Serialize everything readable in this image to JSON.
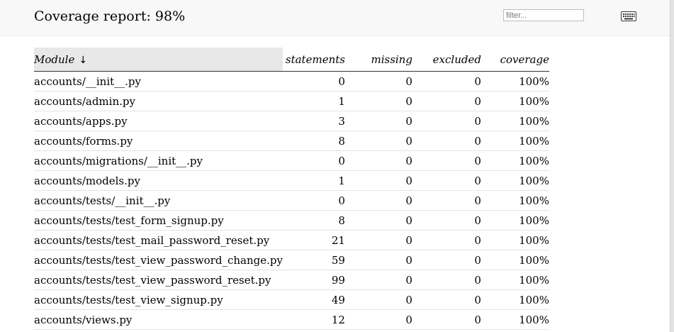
{
  "header": {
    "title": "Coverage report: 98%",
    "filter_placeholder": "filter...",
    "keyboard_icon": "keyboard-icon"
  },
  "table": {
    "columns": {
      "module": "Module",
      "sort_indicator": "↓",
      "statements": "statements",
      "missing": "missing",
      "excluded": "excluded",
      "coverage": "coverage"
    },
    "rows": [
      {
        "module": "accounts/__init__.py",
        "statements": "0",
        "missing": "0",
        "excluded": "0",
        "coverage": "100%"
      },
      {
        "module": "accounts/admin.py",
        "statements": "1",
        "missing": "0",
        "excluded": "0",
        "coverage": "100%"
      },
      {
        "module": "accounts/apps.py",
        "statements": "3",
        "missing": "0",
        "excluded": "0",
        "coverage": "100%"
      },
      {
        "module": "accounts/forms.py",
        "statements": "8",
        "missing": "0",
        "excluded": "0",
        "coverage": "100%"
      },
      {
        "module": "accounts/migrations/__init__.py",
        "statements": "0",
        "missing": "0",
        "excluded": "0",
        "coverage": "100%"
      },
      {
        "module": "accounts/models.py",
        "statements": "1",
        "missing": "0",
        "excluded": "0",
        "coverage": "100%"
      },
      {
        "module": "accounts/tests/__init__.py",
        "statements": "0",
        "missing": "0",
        "excluded": "0",
        "coverage": "100%"
      },
      {
        "module": "accounts/tests/test_form_signup.py",
        "statements": "8",
        "missing": "0",
        "excluded": "0",
        "coverage": "100%"
      },
      {
        "module": "accounts/tests/test_mail_password_reset.py",
        "statements": "21",
        "missing": "0",
        "excluded": "0",
        "coverage": "100%"
      },
      {
        "module": "accounts/tests/test_view_password_change.py",
        "statements": "59",
        "missing": "0",
        "excluded": "0",
        "coverage": "100%"
      },
      {
        "module": "accounts/tests/test_view_password_reset.py",
        "statements": "99",
        "missing": "0",
        "excluded": "0",
        "coverage": "100%"
      },
      {
        "module": "accounts/tests/test_view_signup.py",
        "statements": "49",
        "missing": "0",
        "excluded": "0",
        "coverage": "100%"
      },
      {
        "module": "accounts/views.py",
        "statements": "12",
        "missing": "0",
        "excluded": "0",
        "coverage": "100%"
      }
    ]
  }
}
